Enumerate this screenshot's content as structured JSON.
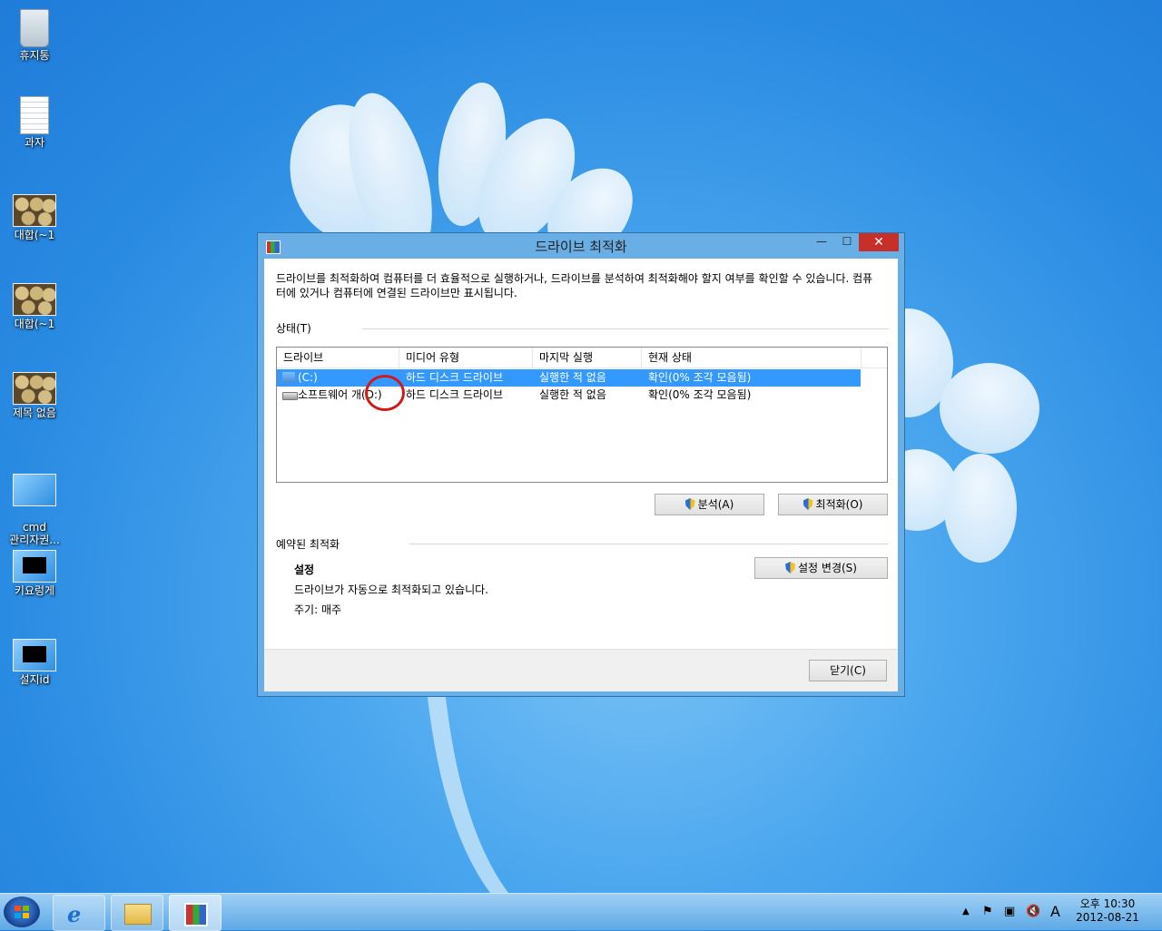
{
  "desktop": {
    "icons": [
      {
        "label": "휴지통",
        "icon": "recycle-bin-icon"
      },
      {
        "label": "과자",
        "icon": "text-document-icon"
      },
      {
        "label": "대합(~1",
        "icon": "image-file-icon"
      },
      {
        "label": "대합(~1",
        "icon": "image-file-icon"
      },
      {
        "label": "제목 없음",
        "icon": "image-file-icon"
      },
      {
        "label": "cmd\n관리자권...",
        "icon": "shortcut-icon"
      },
      {
        "label": "키요렁게",
        "icon": "shortcut-icon"
      },
      {
        "label": "설지id",
        "icon": "shortcut-icon"
      }
    ]
  },
  "window": {
    "title": "드라이브 최적화",
    "description": "드라이브를 최적화하여 컴퓨터를 더 효율적으로 실행하거나, 드라이브를 분석하여 최적화해야 할지 여부를 확인할 수 있습니다. 컴퓨터에 있거나 컴퓨터에 연결된 드라이브만 표시됩니다.",
    "status_label": "상태(T)",
    "columns": [
      "드라이브",
      "미디어 유형",
      "마지막 실행",
      "현재 상태"
    ],
    "drives": [
      {
        "name": "(C:)",
        "media": "하드 디스크 드라이브",
        "last_run": "실행한 적 없음",
        "status": "확인(0% 조각 모음됨)",
        "selected": true
      },
      {
        "name": "소프트웨어 개(D:)",
        "media": "하드 디스크 드라이브",
        "last_run": "실행한 적 없음",
        "status": "확인(0% 조각 모음됨)",
        "selected": false
      }
    ],
    "analyze_button": "분석(A)",
    "optimize_button": "최적화(O)",
    "scheduled_label": "예약된 최적화",
    "settings_heading": "설정",
    "settings_text": "드라이브가 자동으로 최적화되고 있습니다.",
    "frequency": "주기: 매주",
    "change_settings_button": "설정 변경(S)",
    "close_button": "닫기(C)",
    "close_glyph": "✕",
    "minimize_glyph": "—",
    "maximize_glyph": "☐"
  },
  "taskbar": {
    "ime_indicator": "A",
    "clock_time": "오후 10:30",
    "clock_date": "2012-08-21"
  },
  "colors": {
    "selection": "#3399ff",
    "annotation_circle": "#d01a1a",
    "close_button": "#c7302a"
  }
}
